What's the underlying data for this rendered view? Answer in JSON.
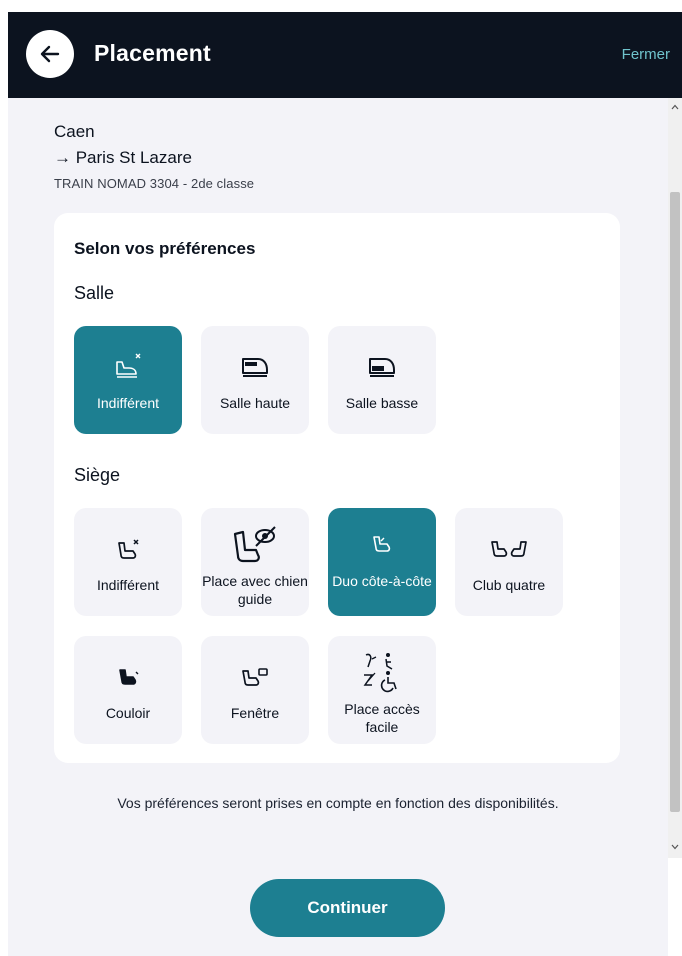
{
  "header": {
    "title": "Placement",
    "close_label": "Fermer",
    "back_icon": "arrow-left-icon"
  },
  "trip": {
    "origin": "Caen",
    "destination": "→ Paris St Lazare",
    "train": "TRAIN NOMAD 3304 - 2de classe"
  },
  "preferences": {
    "title": "Selon vos préférences",
    "salle": {
      "label": "Salle",
      "selected": "Indifférent",
      "options": [
        {
          "label": "Indifférent",
          "icon": "seat-indifferent-icon"
        },
        {
          "label": "Salle haute",
          "icon": "upper-deck-icon"
        },
        {
          "label": "Salle basse",
          "icon": "lower-deck-icon"
        }
      ]
    },
    "siege": {
      "label": "Siège",
      "selected": "Duo côte-à-côte",
      "options": [
        {
          "label": "Indifférent",
          "icon": "seat-indifferent-icon"
        },
        {
          "label": "Place avec chien guide",
          "icon": "guide-dog-seat-icon"
        },
        {
          "label": "Duo côte-à-côte",
          "icon": "duo-seat-icon"
        },
        {
          "label": "Club quatre",
          "icon": "club-four-icon"
        },
        {
          "label": "Couloir",
          "icon": "aisle-seat-icon"
        },
        {
          "label": "Fenêtre",
          "icon": "window-seat-icon"
        },
        {
          "label": "Place accès facile",
          "icon": "accessibility-icon"
        }
      ]
    }
  },
  "note": "Vos préférences seront prises en compte en fonction des disponibilités.",
  "continue_label": "Continuer",
  "colors": {
    "header_bg": "#0c131f",
    "accent": "#1d7f91",
    "link": "#6fc3cc",
    "panel_bg": "#f3f3f8"
  }
}
